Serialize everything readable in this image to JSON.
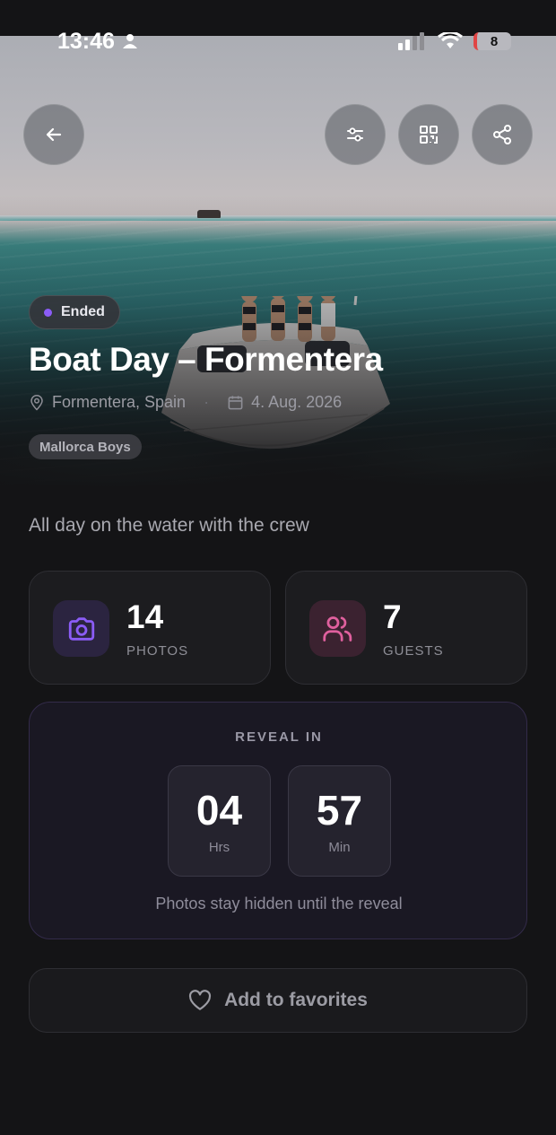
{
  "status_bar": {
    "time": "13:46",
    "battery": "8"
  },
  "event": {
    "status": "Ended",
    "title": "Boat Day – Formentera",
    "location": "Formentera, Spain",
    "date": "4. Aug. 2026",
    "group": "Mallorca Boys",
    "description": "All day on the water with the crew"
  },
  "stats": {
    "photos": {
      "value": "14",
      "label": "PHOTOS"
    },
    "guests": {
      "value": "7",
      "label": "GUESTS"
    }
  },
  "reveal": {
    "title": "REVEAL IN",
    "hours": "04",
    "hours_label": "Hrs",
    "minutes": "57",
    "minutes_label": "Min",
    "note": "Photos stay hidden until the reveal"
  },
  "actions": {
    "favorites_label": "Add to favorites"
  },
  "colors": {
    "accent": "#8b5cf6",
    "photos_icon": "#8b5cf6",
    "guests_icon": "#e0609e",
    "background": "#141416"
  },
  "icons": {
    "back": "arrow-left-icon",
    "filters": "sliders-icon",
    "qr": "qr-code-icon",
    "share": "share-icon",
    "location": "map-pin-icon",
    "calendar": "calendar-icon",
    "photos": "camera-icon",
    "guests": "users-icon",
    "favorite": "heart-icon"
  }
}
